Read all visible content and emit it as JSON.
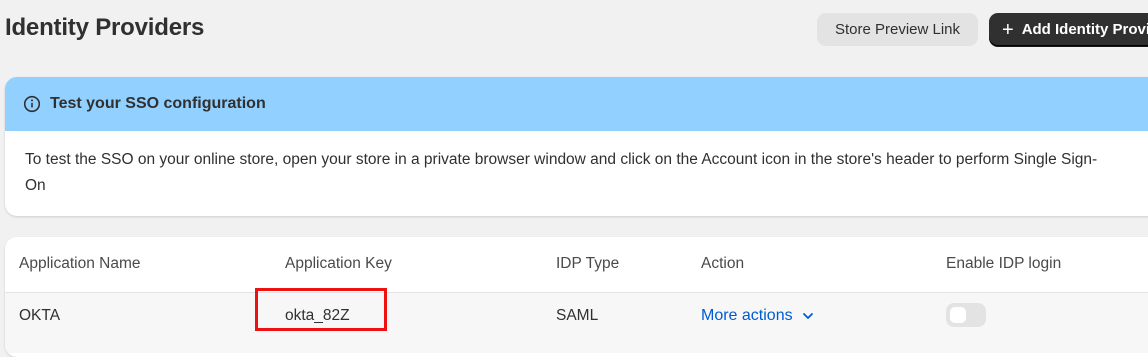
{
  "header": {
    "title": "Identity Providers",
    "store_preview_label": "Store Preview Link",
    "add_provider_label": "Add Identity Provider"
  },
  "banner": {
    "icon": "info-icon",
    "title": "Test your SSO configuration",
    "body": "To test the SSO on your online store, open your store in a private browser window and click on the Account icon in the store's header to perform Single Sign-On",
    "color": "#91d0ff"
  },
  "table": {
    "columns": [
      "Application Name",
      "Application Key",
      "IDP Type",
      "Action",
      "Enable IDP login"
    ],
    "rows": [
      {
        "application_name": "OKTA",
        "application_key": "okta_82Z",
        "idp_type": "SAML",
        "action_label": "More actions",
        "enable_idp_login": false
      }
    ]
  },
  "colors": {
    "primary_button": "#303030",
    "link": "#005bd3",
    "highlight": "#e11111"
  }
}
